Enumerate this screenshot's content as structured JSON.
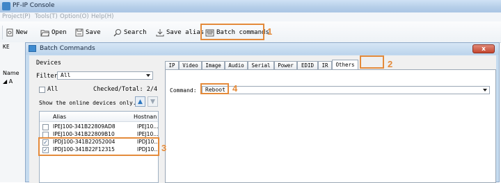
{
  "window": {
    "title": "PF-IP Console"
  },
  "menu": [
    "Project(P)",
    "Tools(T)",
    "Option(O)",
    "Help(H)"
  ],
  "toolbar": {
    "new": "New",
    "open": "Open",
    "save": "Save",
    "search": "Search",
    "save_alias": "Save alias",
    "batch_commands": "Batch commands"
  },
  "main_left": {
    "top_label": "KE",
    "name_label": "Name",
    "tree_item": "A"
  },
  "dialog": {
    "title": "Batch Commands",
    "close_label": "x",
    "devices": {
      "header": "Devices",
      "filter_label": "Filter :",
      "filter_value": "All",
      "all_label": "All",
      "checked_total": "Checked/Total: 2/4",
      "online_label": "Show the online devices only."
    },
    "table": {
      "columns": [
        "Alias",
        "Hostnan"
      ],
      "rows": [
        {
          "alias": "IPEJ100-341B22809AD8",
          "host": "IPEJ10...",
          "checked": false
        },
        {
          "alias": "IPEJ100-341B22809B10",
          "host": "IPEJ10...",
          "checked": false
        },
        {
          "alias": "IPDJ100-341B22052004",
          "host": "IPDJ10...",
          "checked": true
        },
        {
          "alias": "IPDJ100-341B22F12315",
          "host": "IPDJ10...",
          "checked": true
        }
      ]
    },
    "tabs": [
      "IP",
      "Video",
      "Image",
      "Audio",
      "Serial",
      "Power",
      "EDID",
      "IR",
      "Others"
    ],
    "active_tab": "Others",
    "command_label": "Command:",
    "command_value": "Reboot"
  },
  "annotations": [
    "1",
    "2",
    "3",
    "4"
  ],
  "colors": {
    "annotation": "#e48a3a",
    "titlebar": "#b7cfe9",
    "dialog_frame": "#c5dbef"
  }
}
